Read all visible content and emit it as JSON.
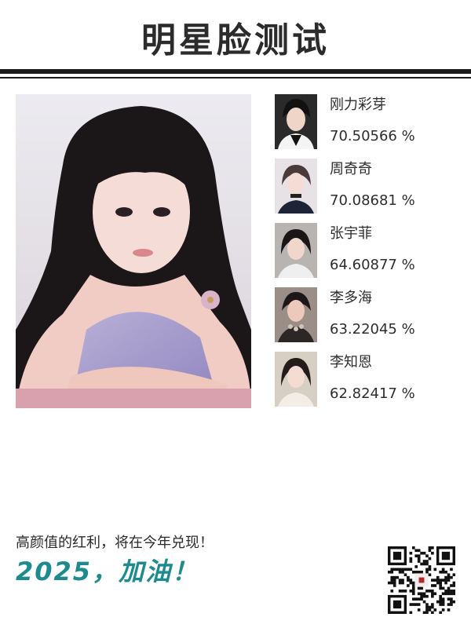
{
  "title": "明星脸测试",
  "main_photo": {
    "alt": "",
    "icon": "portrait-photo"
  },
  "results": [
    {
      "name": "刚力彩芽",
      "score": "70.50566 %"
    },
    {
      "name": "周奇奇",
      "score": "70.08681 %"
    },
    {
      "name": "张宇菲",
      "score": "64.60877 %"
    },
    {
      "name": "李多海",
      "score": "63.22045 %"
    },
    {
      "name": "李知恩",
      "score": "62.82417 %"
    }
  ],
  "footer": {
    "tagline": "高颜值的红利，将在今年兑现！",
    "slogan": "2025，加油！"
  },
  "colors": {
    "accent": "#1f8a8e",
    "text": "#2a2a2a",
    "rule": "#1a1a1a"
  }
}
